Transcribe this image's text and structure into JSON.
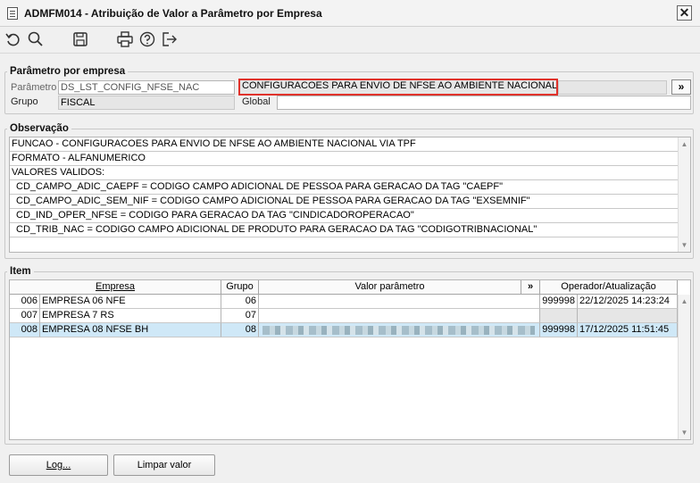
{
  "window": {
    "title": "ADMFM014 - Atribuição de Valor a Parâmetro por Empresa",
    "close_glyph": "✕"
  },
  "toolbar": {
    "icons": [
      "undo-icon",
      "search-icon",
      "save-icon",
      "print-icon",
      "help-icon",
      "exit-icon"
    ]
  },
  "param_section": {
    "legend": "Parâmetro por empresa",
    "parametro_label": "Parâmetro",
    "parametro_value": "DS_LST_CONFIG_NFSE_NAC",
    "description": "CONFIGURACOES PARA ENVIO DE NFSE AO AMBIENTE NACIONAL TPF",
    "expand_label": "»",
    "grupo_label": "Grupo",
    "grupo_value": "FISCAL",
    "global_label": "Global",
    "global_value": ""
  },
  "observacao": {
    "legend": "Observação",
    "lines": [
      "FUNCAO - CONFIGURACOES PARA ENVIO DE NFSE AO AMBIENTE NACIONAL VIA TPF",
      "FORMATO - ALFANUMERICO",
      "VALORES VALIDOS:",
      "  CD_CAMPO_ADIC_CAEPF = CODIGO CAMPO ADICIONAL DE PESSOA PARA GERACAO DA TAG \"CAEPF\"",
      "  CD_CAMPO_ADIC_SEM_NIF = CODIGO CAMPO ADICIONAL DE PESSOA PARA GERACAO DA TAG \"EXSEMNIF\"",
      "  CD_IND_OPER_NFSE = CODIGO PARA GERACAO DA TAG \"CINDICADOROPERACAO\"",
      "  CD_TRIB_NAC = CODIGO CAMPO ADICIONAL DE PRODUTO PARA GERACAO DA TAG \"CODIGOTRIBNACIONAL\""
    ]
  },
  "item": {
    "legend": "Item",
    "columns": {
      "empresa": "Empresa",
      "grupo": "Grupo",
      "valor": "Valor parâmetro",
      "expand": "»",
      "operador": "Operador/Atualização"
    },
    "rows": [
      {
        "code": "006",
        "empresa": "EMPRESA 06 NFE",
        "grupo": "06",
        "valor": "",
        "operador": "999998",
        "data": "22/12/2025 14:23:24"
      },
      {
        "code": "007",
        "empresa": "EMPRESA 7 RS",
        "grupo": "07",
        "valor": "",
        "operador": "",
        "data": ""
      },
      {
        "code": "008",
        "empresa": "EMPRESA 08 NFSE BH",
        "grupo": "08",
        "valor": "",
        "operador": "999998",
        "data": "17/12/2025 11:51:45"
      }
    ]
  },
  "buttons": {
    "log": "Log...",
    "limpar": "Limpar valor"
  },
  "colors": {
    "highlight_border": "#e0322b",
    "selected_row": "#cfe8f7"
  }
}
